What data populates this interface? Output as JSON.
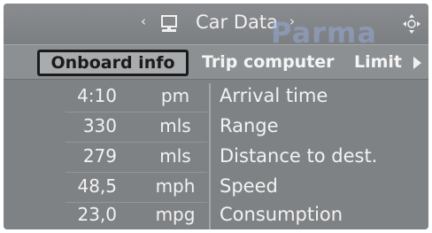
{
  "header": {
    "title": "Car Data",
    "left_arrow": "‹",
    "right_arrow": "›",
    "watermark": "Parma",
    "icons": [
      "monitor-icon",
      "joystick-icon"
    ]
  },
  "tabs": [
    {
      "label": "Onboard info",
      "active": true
    },
    {
      "label": "Trip computer",
      "active": false
    },
    {
      "label": "Limit",
      "active": false
    }
  ],
  "rows": [
    {
      "value": "4:10",
      "unit": "pm",
      "label": "Arrival time"
    },
    {
      "value": "330",
      "unit": "mls",
      "label": "Range"
    },
    {
      "value": "279",
      "unit": "mls",
      "label": "Distance to dest."
    },
    {
      "value": "48,5",
      "unit": "mph",
      "label": "Speed"
    },
    {
      "value": "23,0",
      "unit": "mpg",
      "label": "Consumption"
    }
  ],
  "colors": {
    "background": "#7f8285",
    "tab_bar": "#8d9093",
    "active_tab_fill": "#a9acaf",
    "active_tab_border": "#1b1b1b",
    "text": "#f2f2f2"
  }
}
